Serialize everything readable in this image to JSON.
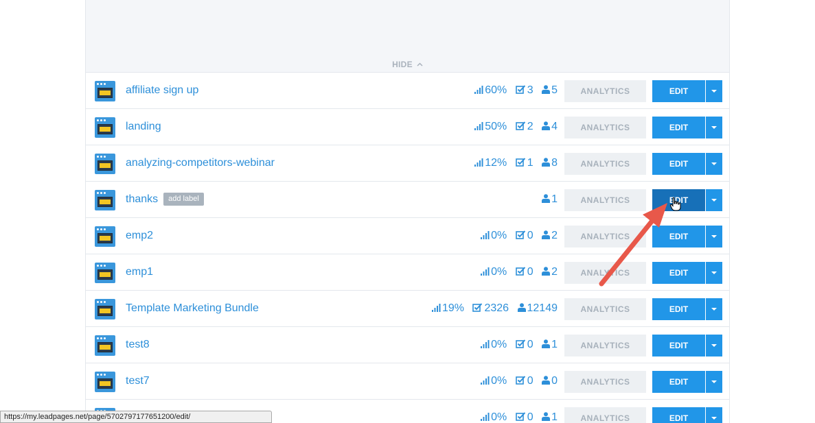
{
  "header": {
    "hide_label": "HIDE"
  },
  "rows": [
    {
      "name": "affiliate sign up",
      "conversion": "60%",
      "conversions": "3",
      "visitors": "5",
      "analytics_label": "ANALYTICS",
      "edit_label": "EDIT"
    },
    {
      "name": "landing",
      "conversion": "50%",
      "conversions": "2",
      "visitors": "4",
      "analytics_label": "ANALYTICS",
      "edit_label": "EDIT"
    },
    {
      "name": "analyzing-competitors-webinar",
      "conversion": "12%",
      "conversions": "1",
      "visitors": "8",
      "analytics_label": "ANALYTICS",
      "edit_label": "EDIT"
    },
    {
      "name": "thanks",
      "label_button": "add label",
      "visitors": "1",
      "analytics_label": "ANALYTICS",
      "edit_label": "EDIT"
    },
    {
      "name": "emp2",
      "conversion": "0%",
      "conversions": "0",
      "visitors": "2",
      "analytics_label": "ANALYTICS",
      "edit_label": "EDIT"
    },
    {
      "name": "emp1",
      "conversion": "0%",
      "conversions": "0",
      "visitors": "2",
      "analytics_label": "ANALYTICS",
      "edit_label": "EDIT"
    },
    {
      "name": "Template Marketing Bundle",
      "conversion": "19%",
      "conversions": "2326",
      "visitors": "12149",
      "analytics_label": "ANALYTICS",
      "edit_label": "EDIT"
    },
    {
      "name": "test8",
      "conversion": "0%",
      "conversions": "0",
      "visitors": "1",
      "analytics_label": "ANALYTICS",
      "edit_label": "EDIT"
    },
    {
      "name": "test7",
      "conversion": "0%",
      "conversions": "0",
      "visitors": "0",
      "analytics_label": "ANALYTICS",
      "edit_label": "EDIT"
    },
    {
      "name": "",
      "conversion": "0%",
      "conversions": "0",
      "visitors": "1",
      "analytics_label": "ANALYTICS",
      "edit_label": "EDIT"
    }
  ],
  "status_bar": {
    "url": "https://my.leadpages.net/page/5702797177651200/edit/"
  },
  "colors": {
    "accent": "#2196e8",
    "link": "#2d8fd9",
    "arrow": "#e8584a"
  },
  "icons": [
    "page-thumbnail-icon",
    "signal-bars-icon",
    "checkbox-icon",
    "user-icon",
    "chevron-up-icon",
    "caret-down-icon",
    "hand-pointer-icon"
  ]
}
